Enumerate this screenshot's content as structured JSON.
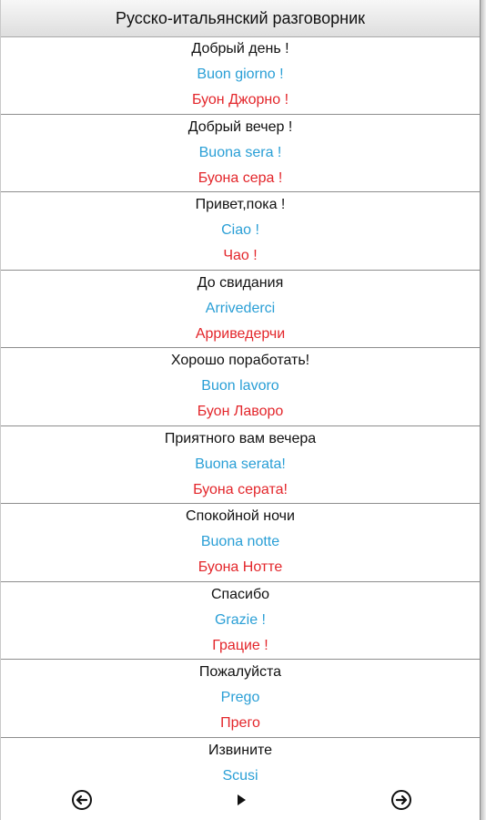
{
  "header": {
    "title": "Русско-итальянский разговорник"
  },
  "phrases": [
    {
      "ru": "Добрый день !",
      "it": "Buon giorno !",
      "tr": "Буон Джорно !"
    },
    {
      "ru": "Добрый  вечер !",
      "it": "Buona sera !",
      "tr": "Буона сера !"
    },
    {
      "ru": "Привет,пока !",
      "it": "Ciao !",
      "tr": "Чао !"
    },
    {
      "ru": "До свидания",
      "it": "Arrivederci",
      "tr": "Арриведерчи"
    },
    {
      "ru": "Хорошо поработать!",
      "it": "Buon lavoro",
      "tr": "Буон Лаворо"
    },
    {
      "ru": "Приятного вам вечера",
      "it": "Buona serata!",
      "tr": "Буона серата!"
    },
    {
      "ru": "Спокойной ночи",
      "it": "Buona notte",
      "tr": "Буона Нотте"
    },
    {
      "ru": "Спасибо",
      "it": "Grazie !",
      "tr": "Грацие !"
    },
    {
      "ru": "Пожалуйста",
      "it": "Prego",
      "tr": "Прего"
    },
    {
      "ru": "Извините",
      "it": "Scusi",
      "tr": ""
    }
  ],
  "colors": {
    "russian": "#111111",
    "italian": "#2a9fd6",
    "transliteration": "#e3262b"
  },
  "nav": {
    "prev_icon": "circle-arrow-left-icon",
    "play_icon": "play-icon",
    "next_icon": "circle-arrow-right-icon"
  }
}
